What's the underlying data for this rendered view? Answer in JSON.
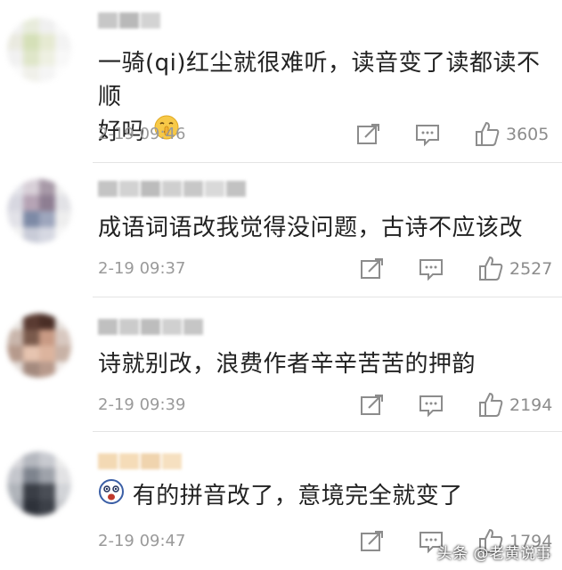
{
  "comments": [
    {
      "text_lines": [
        "一骑(qi)红尘就很难听，读音变了读都读不顺",
        "好吗"
      ],
      "emoji": "shushing-face-emoji",
      "time": "2-19 09:46",
      "likes": "3605"
    },
    {
      "text_lines": [
        "成语词语改我觉得没问题，古诗不应该改"
      ],
      "time": "2-19 09:37",
      "likes": "2527"
    },
    {
      "text_lines": [
        "诗就别改，浪费作者辛辛苦苦的押韵"
      ],
      "time": "2-19 09:39",
      "likes": "2194"
    },
    {
      "text_lines": [
        "有的拼音改了，意境完全就变了"
      ],
      "emoji": "scared-face-emoji",
      "time": "2-19 09:47",
      "likes": "1794"
    }
  ],
  "icons": {
    "share": "share-icon",
    "reply": "comment-icon",
    "like": "thumbs-up-icon"
  },
  "watermark": "头条 @老黄说事"
}
